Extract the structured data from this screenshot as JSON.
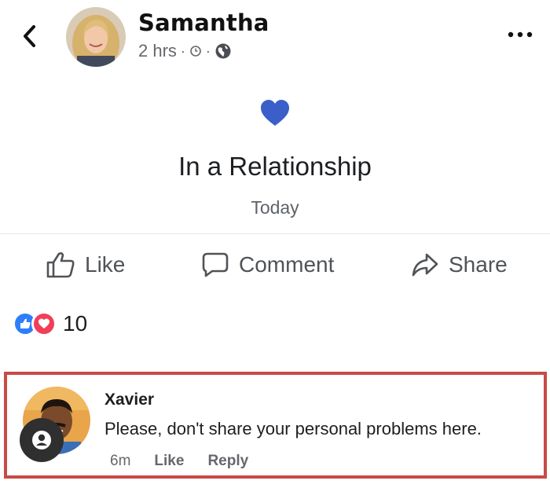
{
  "post": {
    "author": "Samantha",
    "time": "2 hrs",
    "separator": "·"
  },
  "life_event": {
    "title": "In a Relationship",
    "date": "Today",
    "icon": "heart-icon",
    "heart_color": "#3b5fc9"
  },
  "actions": {
    "like_label": "Like",
    "comment_label": "Comment",
    "share_label": "Share"
  },
  "reactions": {
    "count": "10",
    "types": [
      "like",
      "love"
    ]
  },
  "comment": {
    "author": "Xavier",
    "text": "Please, don't share your personal problems here.",
    "time": "6m",
    "like_label": "Like",
    "reply_label": "Reply",
    "highlight_color": "#c84a45"
  }
}
